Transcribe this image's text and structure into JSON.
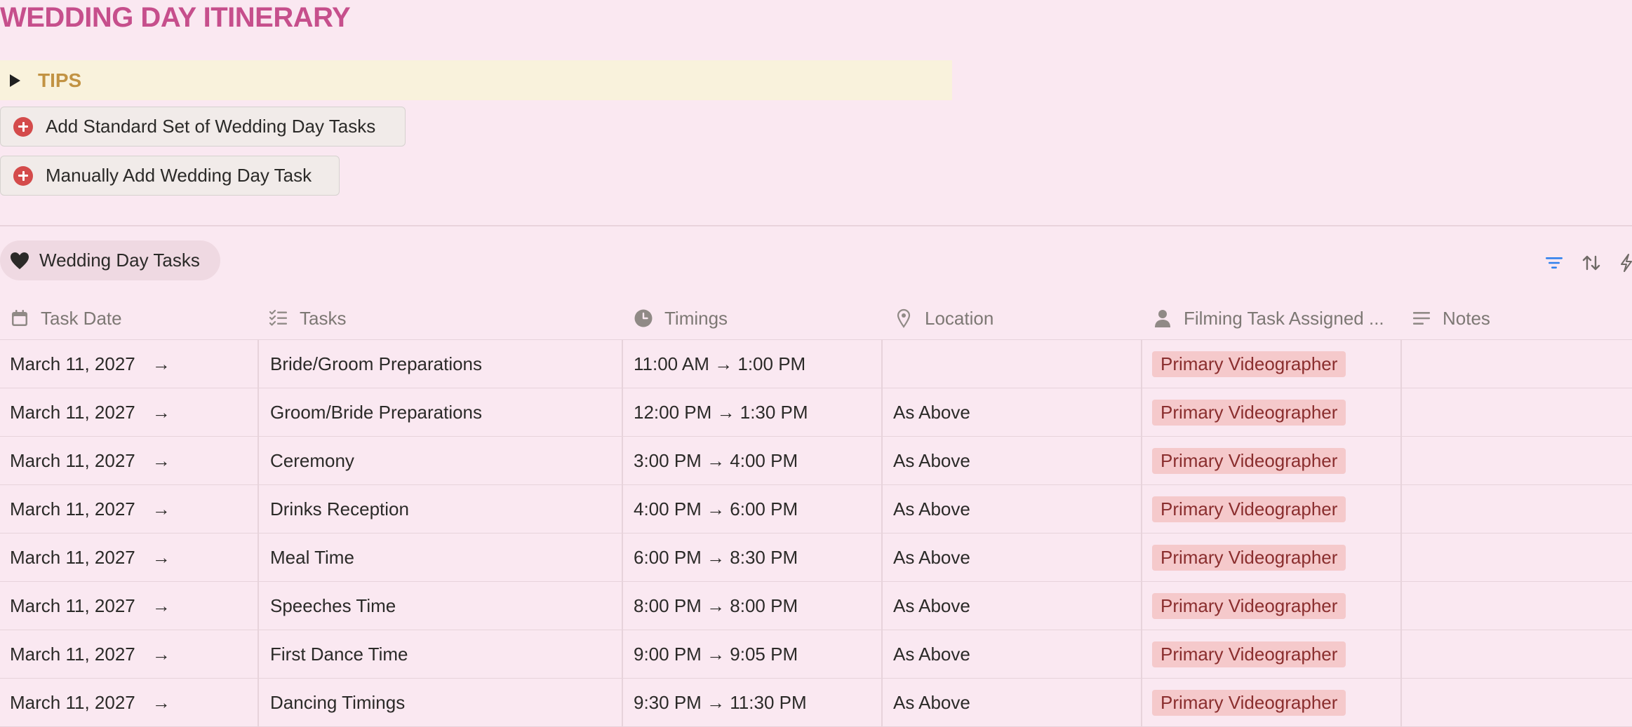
{
  "page": {
    "title": "WEDDING DAY ITINERARY"
  },
  "tips": {
    "label": "TIPS"
  },
  "buttons": {
    "add_standard": "Add Standard Set of Wedding Day Tasks",
    "manual_add": "Manually Add Wedding Day Task"
  },
  "view": {
    "tab_label": "Wedding Day Tasks"
  },
  "table": {
    "headers": {
      "date": "Task Date",
      "tasks": "Tasks",
      "timings": "Timings",
      "location": "Location",
      "assigned": "Filming Task Assigned ...",
      "notes": "Notes"
    },
    "date_arrow": "→",
    "rows": [
      {
        "date": "March 11, 2027",
        "task": "Bride/Groom Preparations",
        "timing": "11:00 AM → 1:00 PM",
        "location": "",
        "assigned": "Primary Videographer",
        "notes": ""
      },
      {
        "date": "March 11, 2027",
        "task": "Groom/Bride Preparations",
        "timing": "12:00 PM → 1:30 PM",
        "location": "As Above",
        "assigned": "Primary Videographer",
        "notes": ""
      },
      {
        "date": "March 11, 2027",
        "task": "Ceremony",
        "timing": "3:00 PM → 4:00 PM",
        "location": "As Above",
        "assigned": "Primary Videographer",
        "notes": ""
      },
      {
        "date": "March 11, 2027",
        "task": "Drinks Reception",
        "timing": "4:00 PM → 6:00 PM",
        "location": "As Above",
        "assigned": "Primary Videographer",
        "notes": ""
      },
      {
        "date": "March 11, 2027",
        "task": "Meal Time",
        "timing": "6:00 PM → 8:30 PM",
        "location": "As Above",
        "assigned": "Primary Videographer",
        "notes": ""
      },
      {
        "date": "March 11, 2027",
        "task": "Speeches Time",
        "timing": "8:00 PM → 8:00 PM",
        "location": "As Above",
        "assigned": "Primary Videographer",
        "notes": ""
      },
      {
        "date": "March 11, 2027",
        "task": "First Dance Time",
        "timing": "9:00 PM → 9:05 PM",
        "location": "As Above",
        "assigned": "Primary Videographer",
        "notes": ""
      },
      {
        "date": "March 11, 2027",
        "task": "Dancing Timings",
        "timing": "9:30 PM → 11:30 PM",
        "location": "As Above",
        "assigned": "Primary Videographer",
        "notes": ""
      }
    ]
  },
  "colors": {
    "background": "#fae8f1",
    "title": "#c64f8c",
    "tips_background": "#f9f2dc",
    "tips_text": "#c29343",
    "tag_background": "#f5c9cb",
    "tag_text": "#8a2e2e",
    "accent_icon": "#2f80ed"
  },
  "icons": {
    "tips_toggle": "triangle-right-icon",
    "buttons": "plus-circle-icon",
    "view_tab": "heart-icon",
    "date_header": "calendar-icon",
    "tasks_header": "checklist-icon",
    "timings_header": "clock-icon",
    "location_header": "pin-icon",
    "assigned_header": "person-icon",
    "notes_header": "text-lines-icon",
    "toolbar": [
      "filter-icon",
      "sort-icon",
      "automation-bolt-icon"
    ]
  }
}
